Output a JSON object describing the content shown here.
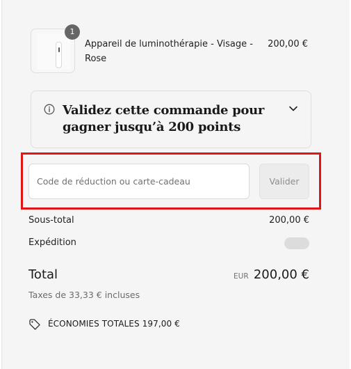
{
  "product": {
    "quantity": "1",
    "name": "Appareil de luminothérapie - Visage - Rose",
    "price": "200,00 €",
    "image": "device-image"
  },
  "rewards": {
    "title": "Validez cette commande pour gagner jusqu’à 200 points",
    "info_icon": "info-icon",
    "toggle_icon": "chevron-down-icon"
  },
  "discount": {
    "placeholder": "Code de réduction ou carte-cadeau",
    "value": "",
    "button_label": "Valider"
  },
  "summary": {
    "subtotal_label": "Sous-total",
    "subtotal_value": "200,00 €",
    "shipping_label": "Expédition",
    "total_label": "Total",
    "currency": "EUR",
    "total_value": "200,00 €",
    "taxes_note": "Taxes de 33,33 € incluses",
    "savings_icon": "tag-icon",
    "savings_text": "ÉCONOMIES TOTALES 197,00 €"
  },
  "colors": {
    "highlight": "#e01515",
    "panel_background": "#f5f5f5",
    "badge": "#666666"
  }
}
